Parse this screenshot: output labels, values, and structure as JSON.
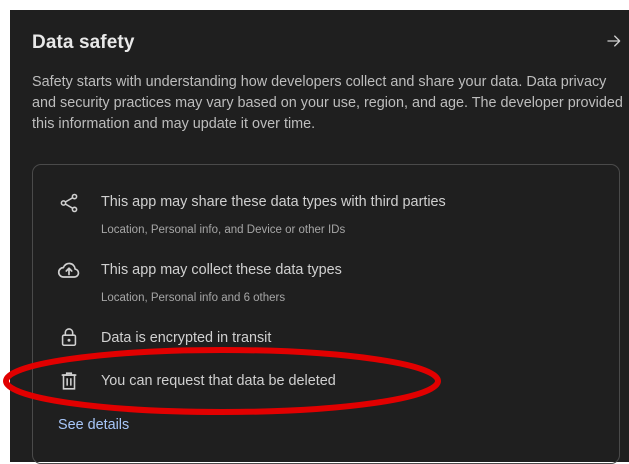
{
  "section": {
    "title": "Data safety",
    "description": "Safety starts with understanding how developers collect and share your data. Data privacy and security practices may vary based on your use, region, and age. The developer provided this information and may update it over time."
  },
  "items": [
    {
      "icon": "share-icon",
      "title": "This app may share these data types with third parties",
      "subtitle": "Location, Personal info, and Device or other IDs"
    },
    {
      "icon": "cloud-upload-icon",
      "title": "This app may collect these data types",
      "subtitle": "Location, Personal info and 6 others"
    },
    {
      "icon": "lock-icon",
      "title": "Data is encrypted in transit"
    },
    {
      "icon": "trash-icon",
      "title": "You can request that data be deleted"
    }
  ],
  "link": {
    "see_details": "See details"
  },
  "colors": {
    "background": "#1f1f1f",
    "link": "#a8c7fa",
    "annotation": "#e10000"
  }
}
